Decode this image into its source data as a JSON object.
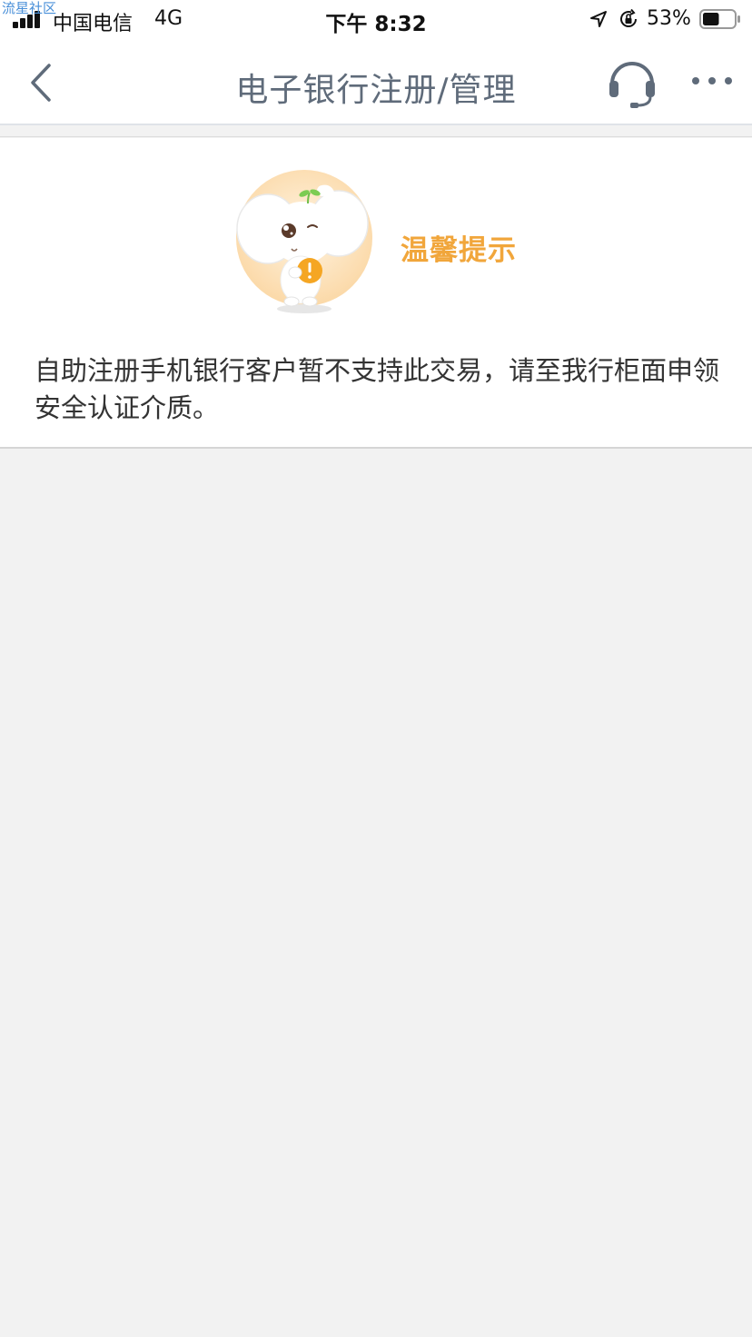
{
  "status_bar": {
    "watermark": "流星社区",
    "carrier": "中国电信",
    "network": "4G",
    "time": "下午 8:32",
    "battery_percent": "53%",
    "battery_level": 0.53
  },
  "nav": {
    "title": "电子银行注册/管理",
    "back_icon": "chevron-left-icon",
    "service_icon": "headset-icon",
    "more_icon": "ellipsis-icon"
  },
  "notice": {
    "title": "温馨提示",
    "message": "自助注册手机银行客户暂不支持此交易，请至我行柜面申领安全认证介质。",
    "title_color": "#f1a63b"
  }
}
